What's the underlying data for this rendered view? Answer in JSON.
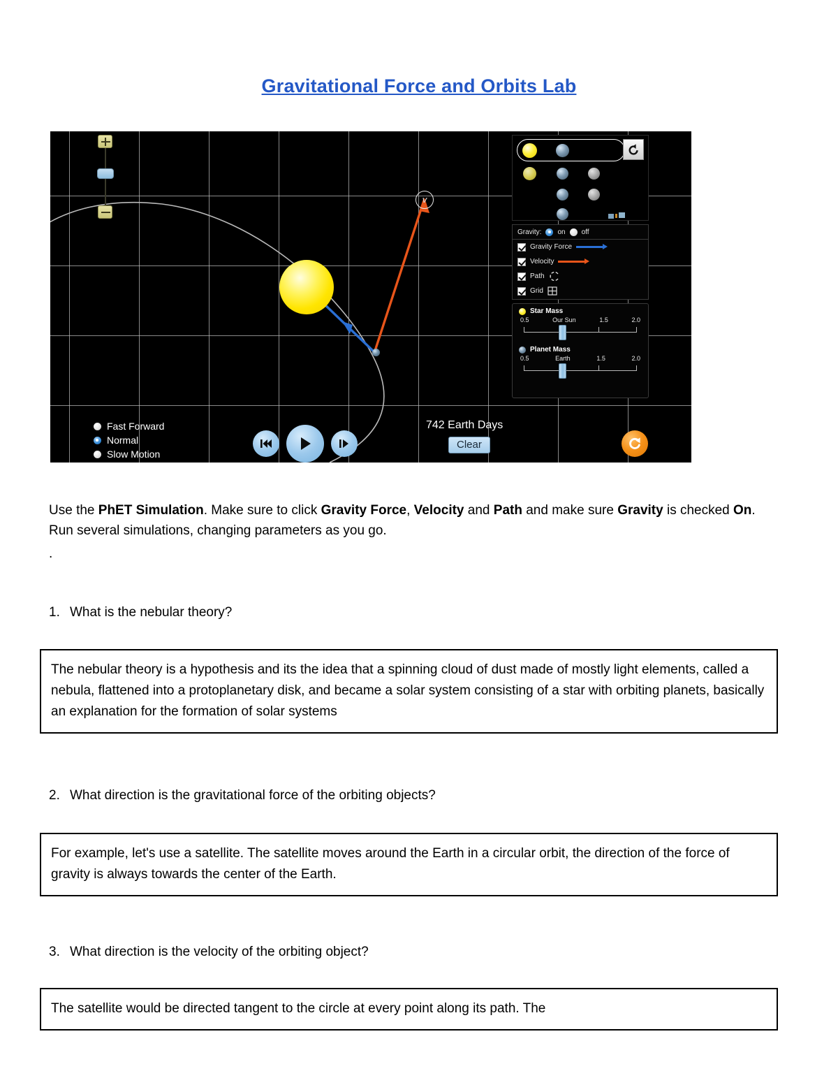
{
  "document": {
    "title": "Gravitational Force and Orbits Lab "
  },
  "instruction": {
    "part1": "Use the ",
    "bold1": "PhET Simulation",
    "part2": ".  Make sure to click ",
    "bold2": "Gravity Force",
    "part3": ", ",
    "bold3": "Velocity",
    "part4": " and ",
    "bold4": "Path",
    "part5": " and make sure ",
    "bold5": "Gravity",
    "part6": " is checked ",
    "bold6": "On",
    "part7": ". Run several simulations, changing parameters as you go.",
    "trailing_dot": "."
  },
  "simulation": {
    "mode_selector": {
      "restart_icon": "restart-arrow-icon",
      "rows": [
        [
          "star-icon",
          "planet-icon"
        ],
        [
          "star-icon",
          "planet-icon",
          "moon-icon"
        ],
        [
          "planet-icon",
          "moon-icon"
        ],
        [
          "planet-icon",
          "satellite-icon"
        ]
      ]
    },
    "gravity": {
      "label": "Gravity:",
      "on_label": "on",
      "off_label": "off",
      "selected": "on"
    },
    "checkboxes": [
      {
        "label": "Gravity Force",
        "checked": true,
        "swatch": "blue-arrow-icon"
      },
      {
        "label": "Velocity",
        "checked": true,
        "swatch": "orange-arrow-icon"
      },
      {
        "label": "Path",
        "checked": true,
        "swatch": "path-icon"
      },
      {
        "label": "Grid",
        "checked": true,
        "swatch": "grid-icon"
      }
    ],
    "star_mass": {
      "title": "Star Mass",
      "ticks": [
        "0.5",
        "Our Sun",
        "1.5",
        "2.0"
      ],
      "value_label": "Our Sun"
    },
    "planet_mass": {
      "title": "Planet Mass",
      "ticks": [
        "0.5",
        "Earth",
        "1.5",
        "2.0"
      ],
      "value_label": "Earth"
    },
    "speed_options": [
      {
        "label": "Fast Forward",
        "selected": false
      },
      {
        "label": "Normal",
        "selected": true
      },
      {
        "label": "Slow Motion",
        "selected": false
      }
    ],
    "playback": {
      "rewind": "rewind-icon",
      "play": "play-icon",
      "step": "step-forward-icon"
    },
    "elapsed_time": "742 Earth Days",
    "clear_label": "Clear",
    "reset_all_icon": "reset-all-icon",
    "velocity_handle_label": "v",
    "colors": {
      "gravity_force_arrow": "#2a6fd4",
      "velocity_arrow": "#e8551a",
      "star": "#ffe500",
      "reset_all": "#f59119",
      "title": "#2458c6"
    }
  },
  "questions": [
    {
      "number": "1.",
      "text": "What is the nebular theory?",
      "answer": "The nebular theory is a hypothesis and its the idea that a spinning cloud of dust made of mostly light elements, called a nebula, flattened into a protoplanetary disk, and became a solar system consisting of a star with orbiting planets, basically an explanation for the formation of solar systems"
    },
    {
      "number": "2.",
      "text": "What direction is the gravitational force of the orbiting objects?",
      "answer": "For example, let's use a satellite. The satellite moves around the Earth in a circular orbit, the direction of the force of gravity is always towards the center of the Earth."
    },
    {
      "number": "3.",
      "text": "What direction is the velocity of the orbiting object?",
      "answer": "The satellite would be directed tangent to the circle at every point along its path. The"
    }
  ]
}
